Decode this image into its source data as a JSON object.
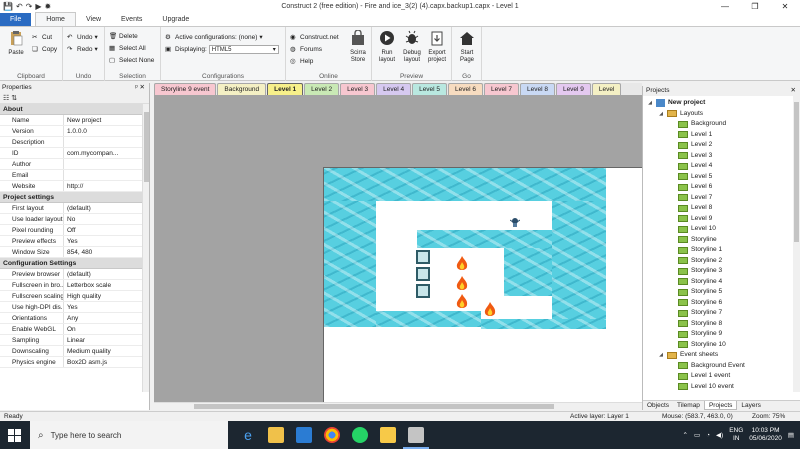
{
  "window": {
    "title": "Construct 2  (free edition) - Fire and ice_3(2) (4).capx.backup1.capx - Level 1"
  },
  "ribbon_tabs": [
    "File",
    "Home",
    "View",
    "Events",
    "Upgrade"
  ],
  "ribbon": {
    "clipboard": {
      "label": "Clipboard",
      "paste": "Paste",
      "cut": "Cut",
      "copy": "Copy"
    },
    "undo": {
      "label": "Undo",
      "undo": "Undo",
      "redo": "Redo"
    },
    "selection": {
      "label": "Selection",
      "delete": "Delete",
      "select_all": "Select All",
      "select_none": "Select None"
    },
    "configurations": {
      "label": "Configurations",
      "active": "Active configurations: (none)",
      "displaying_label": "Displaying:",
      "displaying_value": "HTML5"
    },
    "online": {
      "label": "Online",
      "construct_net": "Construct.net",
      "forums": "Forums",
      "help": "Help",
      "scirra_store": "Scirra Store"
    },
    "preview": {
      "label": "Preview",
      "run": "Run layout",
      "debug": "Debug layout",
      "export": "Export project"
    },
    "go": {
      "label": "Go",
      "start": "Start Page"
    }
  },
  "properties": {
    "title": "Properties",
    "pin": "ᵖ",
    "close": "✕",
    "sections": [
      {
        "title": "About",
        "rows": [
          {
            "k": "Name",
            "v": "New project"
          },
          {
            "k": "Version",
            "v": "1.0.0.0"
          },
          {
            "k": "Description",
            "v": ""
          },
          {
            "k": "ID",
            "v": "com.mycompan..."
          },
          {
            "k": "Author",
            "v": ""
          },
          {
            "k": "Email",
            "v": ""
          },
          {
            "k": "Website",
            "v": "http://"
          }
        ]
      },
      {
        "title": "Project settings",
        "rows": [
          {
            "k": "First layout",
            "v": "(default)"
          },
          {
            "k": "Use loader layout",
            "v": "No"
          },
          {
            "k": "Pixel rounding",
            "v": "Off"
          },
          {
            "k": "Preview effects",
            "v": "Yes"
          },
          {
            "k": "Window Size",
            "v": "854, 480"
          }
        ]
      },
      {
        "title": "Configuration Settings",
        "rows": [
          {
            "k": "Preview browser",
            "v": "(default)"
          },
          {
            "k": "Fullscreen in bro...",
            "v": "Letterbox scale"
          },
          {
            "k": "Fullscreen scaling",
            "v": "High quality"
          },
          {
            "k": "Use high-DPI dis...",
            "v": "Yes"
          },
          {
            "k": "Orientations",
            "v": "Any"
          },
          {
            "k": "Enable WebGL",
            "v": "On"
          },
          {
            "k": "Sampling",
            "v": "Linear"
          },
          {
            "k": "Downscaling",
            "v": "Medium quality"
          },
          {
            "k": "Physics engine",
            "v": "Box2D asm.js"
          }
        ]
      }
    ]
  },
  "layout_tabs": [
    {
      "label": "Storyline 9 event",
      "color": "#f7c7d0",
      "active": false
    },
    {
      "label": "Background",
      "color": "#f4f0c4",
      "active": false
    },
    {
      "label": "Level 1",
      "color": "#f7f08a",
      "active": true
    },
    {
      "label": "Level 2",
      "color": "#c9e9b5",
      "active": false
    },
    {
      "label": "Level 3",
      "color": "#f7c7d0",
      "active": false
    },
    {
      "label": "Level 4",
      "color": "#d6c9f0",
      "active": false
    },
    {
      "label": "Level 5",
      "color": "#b9e8e0",
      "active": false
    },
    {
      "label": "Level 6",
      "color": "#f7dcc0",
      "active": false
    },
    {
      "label": "Level 7",
      "color": "#f7c7d0",
      "active": false
    },
    {
      "label": "Level 8",
      "color": "#c9d9f4",
      "active": false
    },
    {
      "label": "Level 9",
      "color": "#e4c9f0",
      "active": false
    },
    {
      "label": "Level",
      "color": "#f4f0c4",
      "active": false
    }
  ],
  "projects": {
    "title": "Projects",
    "tree": [
      {
        "label": "New project",
        "level": 0,
        "kind": "project",
        "bold": true,
        "expanded": true
      },
      {
        "label": "Layouts",
        "level": 1,
        "kind": "folder",
        "expanded": true
      },
      {
        "label": "Background",
        "level": 2,
        "kind": "layout"
      },
      {
        "label": "Level 1",
        "level": 2,
        "kind": "layout"
      },
      {
        "label": "Level 2",
        "level": 2,
        "kind": "layout"
      },
      {
        "label": "Level 3",
        "level": 2,
        "kind": "layout"
      },
      {
        "label": "Level 4",
        "level": 2,
        "kind": "layout"
      },
      {
        "label": "Level 5",
        "level": 2,
        "kind": "layout"
      },
      {
        "label": "Level 6",
        "level": 2,
        "kind": "layout"
      },
      {
        "label": "Level 7",
        "level": 2,
        "kind": "layout"
      },
      {
        "label": "Level 8",
        "level": 2,
        "kind": "layout"
      },
      {
        "label": "Level 9",
        "level": 2,
        "kind": "layout"
      },
      {
        "label": "Level 10",
        "level": 2,
        "kind": "layout"
      },
      {
        "label": "Storyline",
        "level": 2,
        "kind": "layout"
      },
      {
        "label": "Storyline 1",
        "level": 2,
        "kind": "layout"
      },
      {
        "label": "Storyline 2",
        "level": 2,
        "kind": "layout"
      },
      {
        "label": "Storyline 3",
        "level": 2,
        "kind": "layout"
      },
      {
        "label": "Storyline 4",
        "level": 2,
        "kind": "layout"
      },
      {
        "label": "Storyline 5",
        "level": 2,
        "kind": "layout"
      },
      {
        "label": "Storyline 6",
        "level": 2,
        "kind": "layout"
      },
      {
        "label": "Storyline 7",
        "level": 2,
        "kind": "layout"
      },
      {
        "label": "Storyline 8",
        "level": 2,
        "kind": "layout"
      },
      {
        "label": "Storyline 9",
        "level": 2,
        "kind": "layout"
      },
      {
        "label": "Storyline 10",
        "level": 2,
        "kind": "layout"
      },
      {
        "label": "Event sheets",
        "level": 1,
        "kind": "folder",
        "expanded": true
      },
      {
        "label": "Background Event",
        "level": 2,
        "kind": "layout"
      },
      {
        "label": "Level 1 event",
        "level": 2,
        "kind": "layout"
      },
      {
        "label": "Level 10 event",
        "level": 2,
        "kind": "layout"
      }
    ],
    "tabs": [
      "Objects",
      "Tilemap",
      "Projects",
      "Layers"
    ],
    "active_tab": "Projects"
  },
  "status": {
    "left": "Ready",
    "active_layer": "Active layer: Layer 1",
    "mouse": "Mouse: (583.7, 463.0, 0)",
    "zoom": "Zoom: 75%"
  },
  "taskbar": {
    "search_placeholder": "Type here to search",
    "lang1": "ENG",
    "lang2": "IN",
    "time": "10:03 PM",
    "date": "05/06/2020"
  }
}
